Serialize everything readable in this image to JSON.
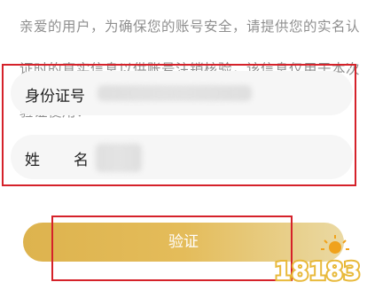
{
  "intro": {
    "line1": "亲爱的用户，为确保您的账号安全，请提供您的实名认",
    "line2": "证时的真实信息以供账号注销核验，该信息仅用于本次",
    "line3": "验证使用："
  },
  "form": {
    "id_label": "身份证号",
    "name_label": "姓名"
  },
  "button": {
    "verify_label": "验证"
  },
  "watermark": {
    "text": "18183"
  },
  "colors": {
    "highlight_box": "#d5222a",
    "button_gold": "#ddb34e",
    "field_bg": "#f6f6f6"
  }
}
